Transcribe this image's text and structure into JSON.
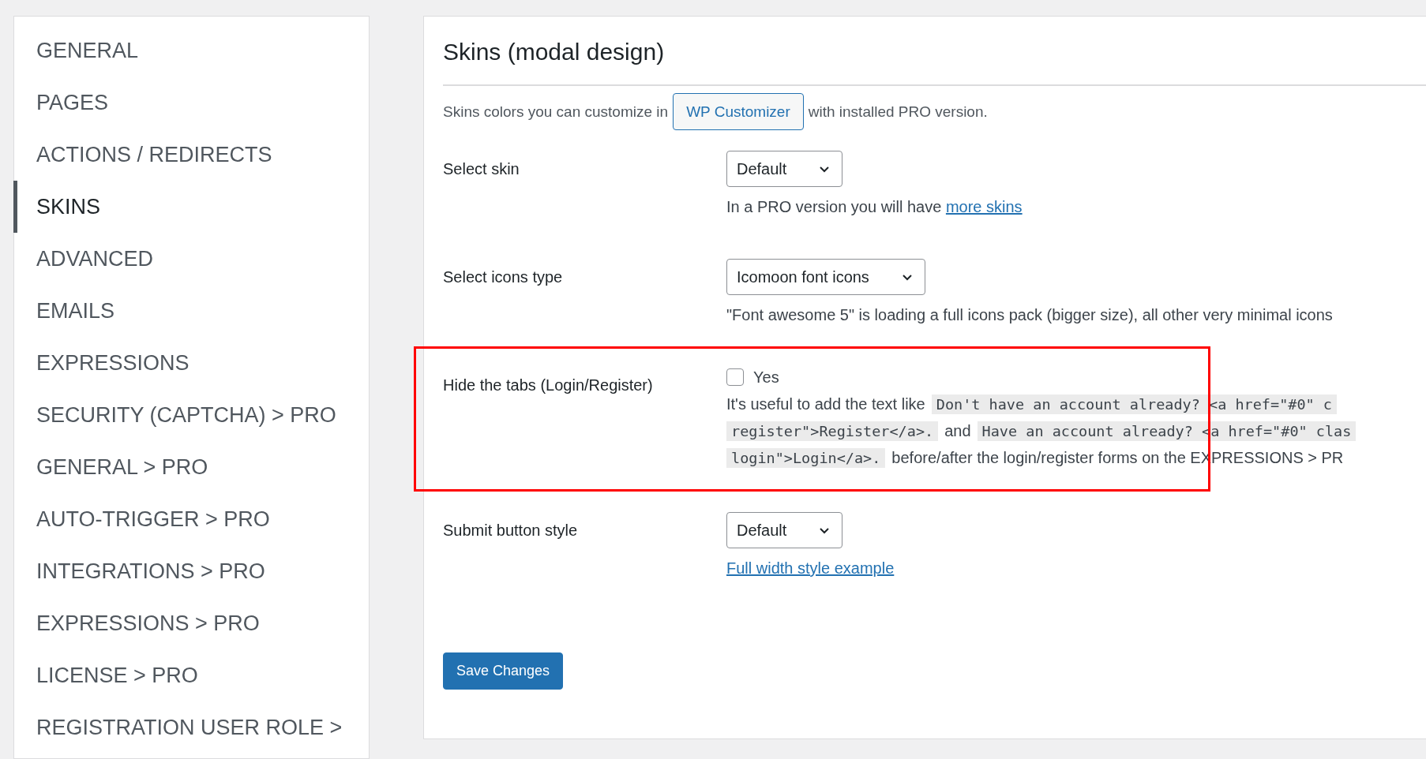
{
  "sidebar": {
    "items": [
      {
        "label": "GENERAL",
        "selected": false
      },
      {
        "label": "PAGES",
        "selected": false
      },
      {
        "label": "ACTIONS / REDIRECTS",
        "selected": false
      },
      {
        "label": "SKINS",
        "selected": true
      },
      {
        "label": "ADVANCED",
        "selected": false
      },
      {
        "label": "EMAILS",
        "selected": false
      },
      {
        "label": "EXPRESSIONS",
        "selected": false
      },
      {
        "label": "SECURITY (CAPTCHA) > PRO",
        "selected": false
      },
      {
        "label": "GENERAL > PRO",
        "selected": false
      },
      {
        "label": "AUTO-TRIGGER > PRO",
        "selected": false
      },
      {
        "label": "INTEGRATIONS > PRO",
        "selected": false
      },
      {
        "label": "EXPRESSIONS > PRO",
        "selected": false
      },
      {
        "label": "LICENSE > PRO",
        "selected": false
      },
      {
        "label": "REGISTRATION USER ROLE >",
        "selected": false
      }
    ]
  },
  "section": {
    "title": "Skins (modal design)",
    "intro": {
      "before": "Skins colors you can customize in",
      "button": "WP Customizer",
      "after": "with installed PRO version."
    },
    "rows": [
      {
        "kind": "select",
        "label": "Select skin",
        "value": "Default",
        "highlighted": false,
        "help": [
          {
            "kind": "text",
            "text": "In a PRO version you will have "
          },
          {
            "kind": "link",
            "text": "more skins"
          }
        ]
      },
      {
        "kind": "select",
        "label": "Select icons type",
        "value": "Icomoon font icons",
        "highlighted": false,
        "help": [
          {
            "kind": "text",
            "text": "\"Font awesome 5\" is loading a full icons pack (bigger size), all other very minimal icons"
          }
        ]
      },
      {
        "kind": "checkbox",
        "label": "Hide the tabs (Login/Register)",
        "option": "Yes",
        "checked": false,
        "highlighted": true,
        "lines": [
          [
            {
              "kind": "text",
              "text": "It's useful to add the text like"
            },
            {
              "kind": "code",
              "text": "Don't have an account already? <a href=\"#0\" c"
            }
          ],
          [
            {
              "kind": "code",
              "text": "register\">Register</a>."
            },
            {
              "kind": "text",
              "text": "and"
            },
            {
              "kind": "code",
              "text": "Have an account already? <a href=\"#0\" clas"
            }
          ],
          [
            {
              "kind": "code",
              "text": "login\">Login</a>."
            },
            {
              "kind": "text",
              "text": "before/after the login/register forms on the EXPRESSIONS > PR"
            }
          ]
        ]
      },
      {
        "kind": "select",
        "label": "Submit button style",
        "value": "Default",
        "highlighted": false,
        "help": [
          {
            "kind": "link",
            "text": "Full width style example"
          }
        ]
      }
    ],
    "save_button": "Save Changes"
  }
}
